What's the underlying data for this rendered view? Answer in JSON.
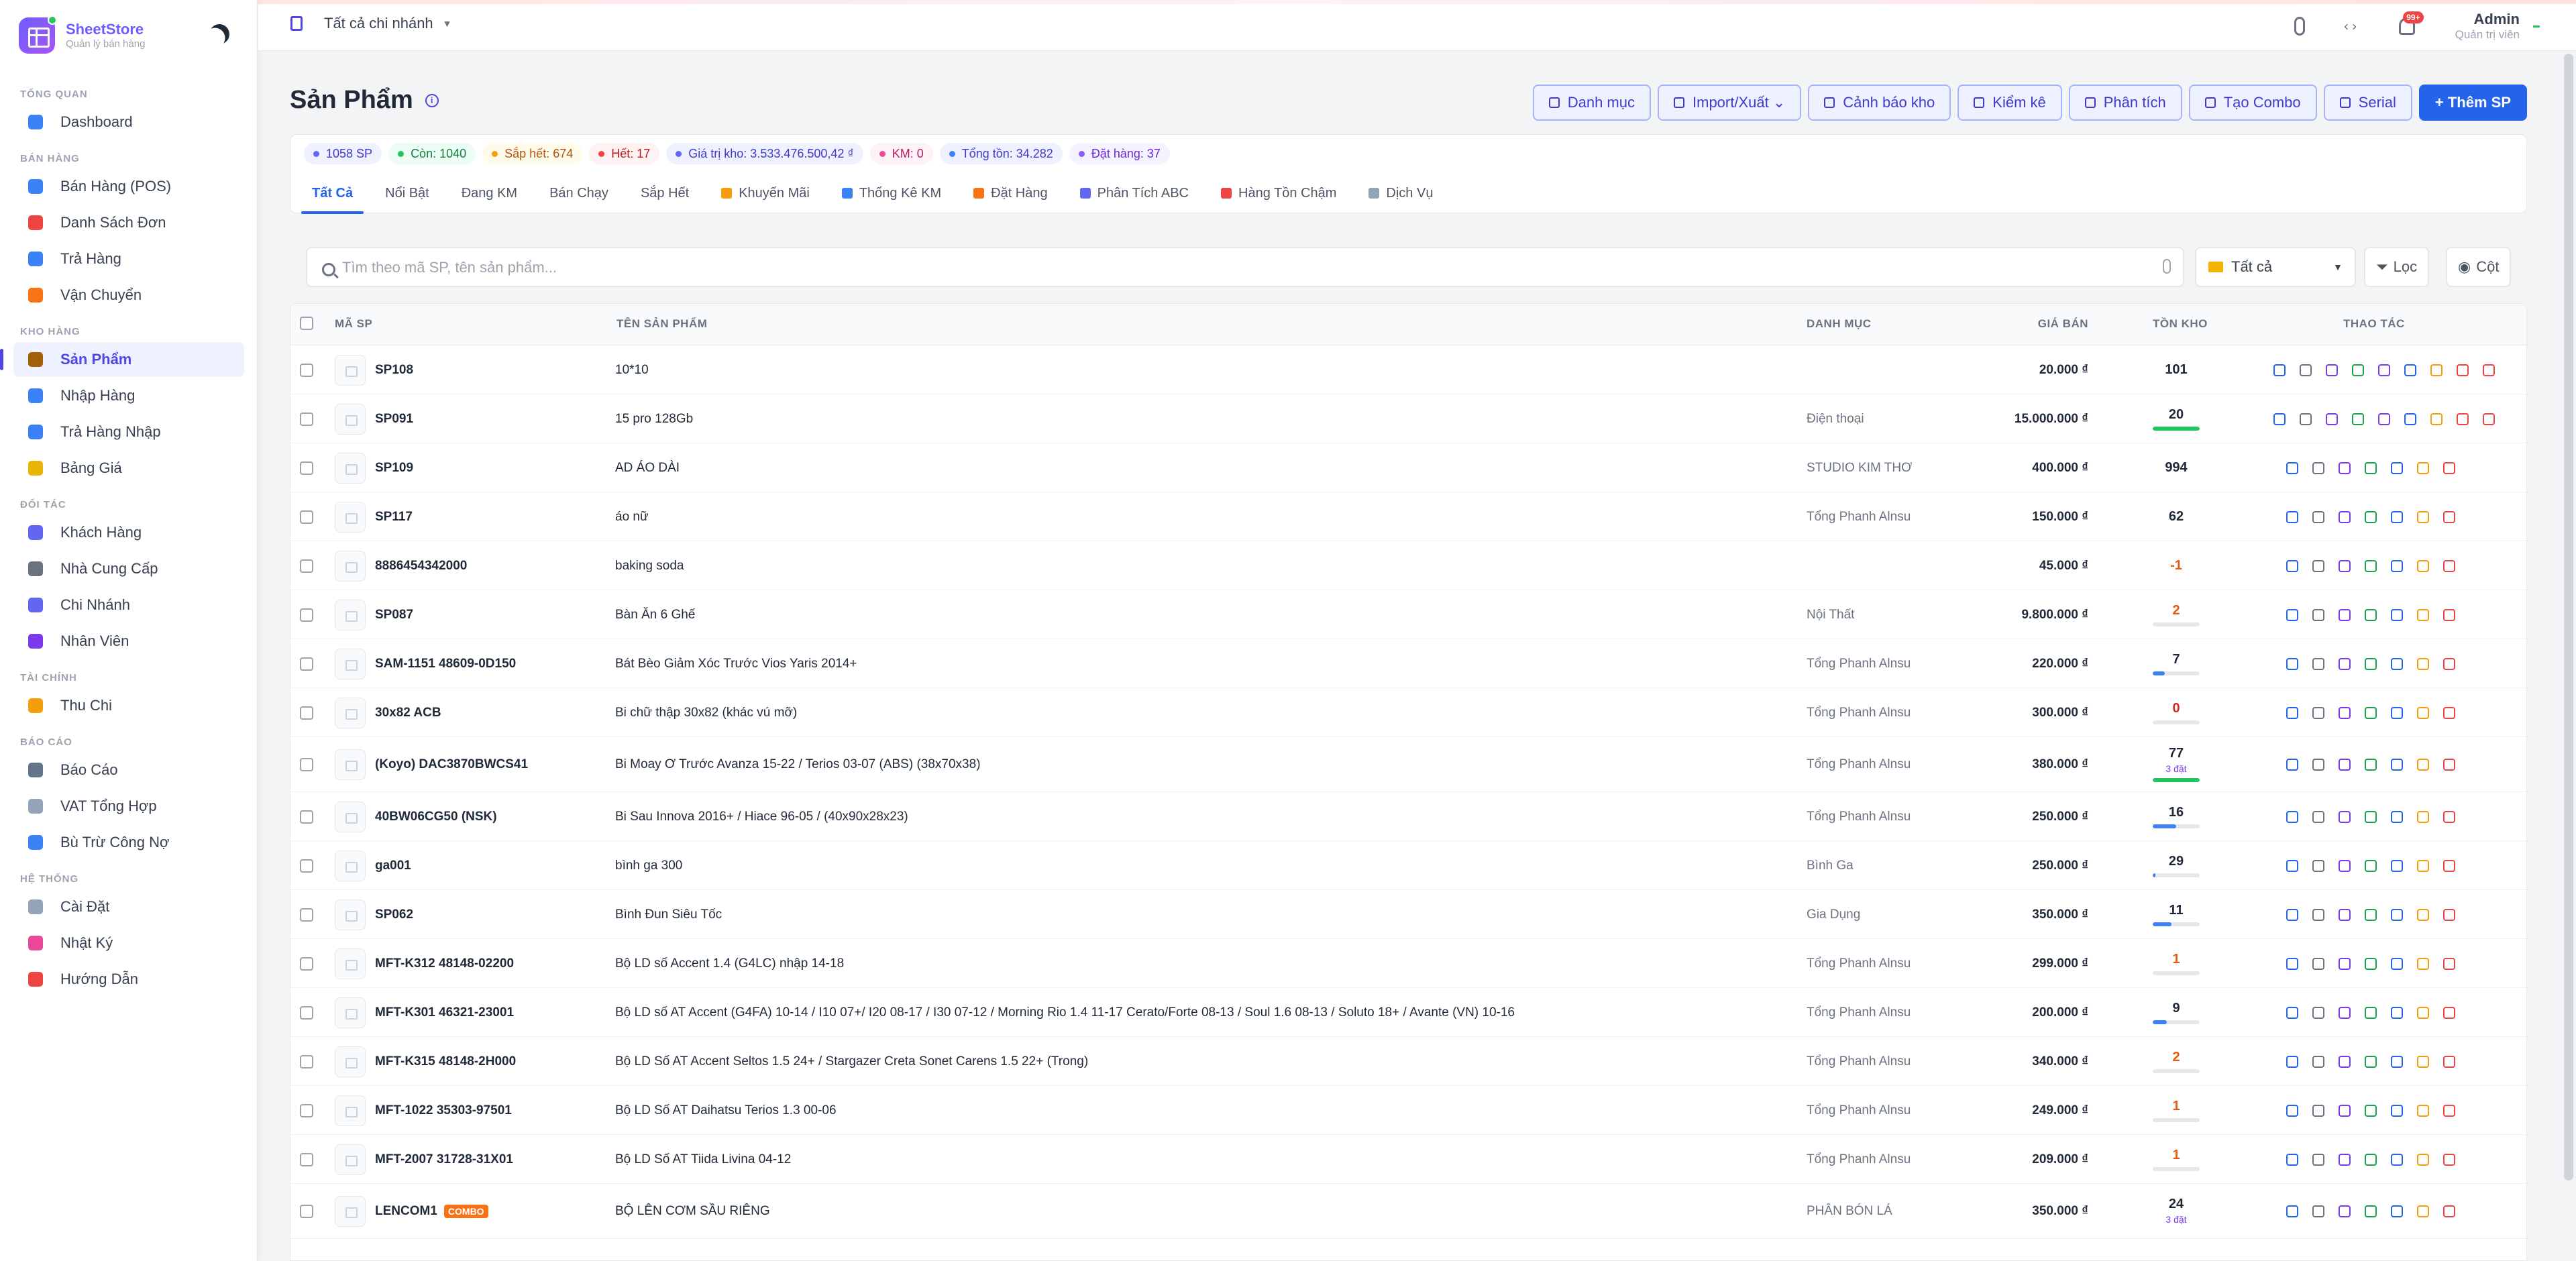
{
  "app": {
    "name": "SheetStore",
    "subtitle": "Quản lý bán hàng"
  },
  "sidebar": {
    "sections": [
      {
        "title": "TỔNG QUAN",
        "items": [
          {
            "label": "Dashboard",
            "color": "#3b82f6"
          }
        ]
      },
      {
        "title": "BÁN HÀNG",
        "items": [
          {
            "label": "Bán Hàng (POS)",
            "color": "#3b82f6"
          },
          {
            "label": "Danh Sách Đơn",
            "color": "#ef4444"
          },
          {
            "label": "Trả Hàng",
            "color": "#3b82f6"
          },
          {
            "label": "Vận Chuyển",
            "color": "#f97316"
          }
        ]
      },
      {
        "title": "KHO HÀNG",
        "items": [
          {
            "label": "Sản Phẩm",
            "color": "#a16207",
            "active": true
          },
          {
            "label": "Nhập Hàng",
            "color": "#3b82f6"
          },
          {
            "label": "Trả Hàng Nhập",
            "color": "#3b82f6"
          },
          {
            "label": "Bảng Giá",
            "color": "#eab308"
          }
        ]
      },
      {
        "title": "ĐỐI TÁC",
        "items": [
          {
            "label": "Khách Hàng",
            "color": "#6366f1"
          },
          {
            "label": "Nhà Cung Cấp",
            "color": "#6b7280"
          },
          {
            "label": "Chi Nhánh",
            "color": "#6366f1"
          },
          {
            "label": "Nhân Viên",
            "color": "#7c3aed"
          }
        ]
      },
      {
        "title": "TÀI CHÍNH",
        "items": [
          {
            "label": "Thu Chi",
            "color": "#f59e0b"
          }
        ]
      },
      {
        "title": "BÁO CÁO",
        "items": [
          {
            "label": "Báo Cáo",
            "color": "#64748b"
          },
          {
            "label": "VAT Tổng Hợp",
            "color": "#94a3b8"
          },
          {
            "label": "Bù Trừ Công Nợ",
            "color": "#3b82f6"
          }
        ]
      },
      {
        "title": "HỆ THỐNG",
        "items": [
          {
            "label": "Cài Đặt",
            "color": "#94a3b8"
          },
          {
            "label": "Nhật Ký",
            "color": "#ec4899"
          },
          {
            "label": "Hướng Dẫn",
            "color": "#ef4444"
          }
        ]
      }
    ]
  },
  "topbar": {
    "branch": "Tất cả chi nhánh",
    "notif_count": "99+",
    "user_name": "Admin",
    "user_role": "Quản trị viên"
  },
  "page": {
    "title": "Sản Phẩm"
  },
  "actions": [
    {
      "label": "Danh mục"
    },
    {
      "label": "Import/Xuất ⌄"
    },
    {
      "label": "Cảnh báo kho"
    },
    {
      "label": "Kiểm kê"
    },
    {
      "label": "Phân tích"
    },
    {
      "label": "Tạo Combo"
    },
    {
      "label": "Serial"
    },
    {
      "label": "+ Thêm SP",
      "primary": true
    }
  ],
  "stats": [
    {
      "label": "1058 SP",
      "bg": "#eef2ff",
      "fg": "#4338ca",
      "dot": "#6366f1"
    },
    {
      "label": "Còn: 1040",
      "bg": "#ecfdf5",
      "fg": "#15803d",
      "dot": "#22c55e"
    },
    {
      "label": "Sắp hết: 674",
      "bg": "#fffbeb",
      "fg": "#b45309",
      "dot": "#f59e0b"
    },
    {
      "label": "Hết: 17",
      "bg": "#fef2f2",
      "fg": "#b91c1c",
      "dot": "#ef4444"
    },
    {
      "label": "Giá trị kho: 3.533.476.500,42 ₫",
      "bg": "#eef2ff",
      "fg": "#4338ca",
      "dot": "#6366f1"
    },
    {
      "label": "KM: 0",
      "bg": "#fdf2f8",
      "fg": "#be185d",
      "dot": "#ec4899"
    },
    {
      "label": "Tổng tồn: 34.282",
      "bg": "#eef2ff",
      "fg": "#4338ca",
      "dot": "#3b82f6"
    },
    {
      "label": "Đặt hàng: 37",
      "bg": "#f5f3ff",
      "fg": "#6d28d9",
      "dot": "#8b5cf6"
    }
  ],
  "tabs": [
    {
      "label": "Tất Cả",
      "active": true
    },
    {
      "label": "Nổi Bật"
    },
    {
      "label": "Đang KM"
    },
    {
      "label": "Bán Chạy"
    },
    {
      "label": "Sắp Hết"
    },
    {
      "label": "Khuyến Mãi",
      "icon": "#f59e0b"
    },
    {
      "label": "Thống Kê KM",
      "icon": "#3b82f6"
    },
    {
      "label": "Đặt Hàng",
      "icon": "#f97316"
    },
    {
      "label": "Phân Tích ABC",
      "icon": "#6366f1"
    },
    {
      "label": "Hàng Tồn Chậm",
      "icon": "#ef4444"
    },
    {
      "label": "Dịch Vụ",
      "icon": "#94a3b8"
    }
  ],
  "search": {
    "placeholder": "Tìm theo mã SP, tên sản phẩm...",
    "category": "Tất cả",
    "filter": "Lọc",
    "columns": "Cột"
  },
  "table": {
    "headers": {
      "code": "MÃ SP",
      "name": "TÊN SẢN PHẨM",
      "category": "DANH MỤC",
      "price": "GIÁ BÁN",
      "stock": "TỒN KHO",
      "ops": "THAO TÁC"
    },
    "rows": [
      {
        "code": "SP108",
        "name": "10*10",
        "category": "",
        "price": "20.000 ₫",
        "stock": "101",
        "stock_color": "#1f2937",
        "bar": null,
        "ops": 9
      },
      {
        "code": "SP091",
        "name": "15 pro 128Gb",
        "category": "Điện thoại",
        "price": "15.000.000 ₫",
        "stock": "20",
        "stock_color": "#1f2937",
        "bar": 1,
        "bar_color": "#22c55e",
        "ops": 9
      },
      {
        "code": "SP109",
        "name": "AD ÁO DÀI",
        "category": "STUDIO KIM THƠ",
        "price": "400.000 ₫",
        "stock": "994",
        "stock_color": "#1f2937",
        "bar": null,
        "ops": 7
      },
      {
        "code": "SP117",
        "name": "áo nữ",
        "category": "Tổng Phanh Alnsu",
        "price": "150.000 ₫",
        "stock": "62",
        "stock_color": "#1f2937",
        "bar": null,
        "ops": 7
      },
      {
        "code": "8886454342000",
        "name": "baking soda",
        "category": "",
        "price": "45.000 ₫",
        "stock": "-1",
        "stock_color": "#ea580c",
        "bar": null,
        "ops": 7
      },
      {
        "code": "SP087",
        "name": "Bàn Ăn 6 Ghế",
        "category": "Nội Thất",
        "price": "9.800.000 ₫",
        "stock": "2",
        "stock_color": "#ea580c",
        "bar": 0,
        "bar_color": "#f59e0b",
        "ops": 7
      },
      {
        "code": "SAM-1151 48609-0D150",
        "name": "Bát Bèo Giảm Xóc Trước Vios Yaris 2014+",
        "category": "Tổng Phanh Alnsu",
        "price": "220.000 ₫",
        "stock": "7",
        "stock_color": "#1f2937",
        "bar": 0.25,
        "bar_color": "#3b82f6",
        "ops": 7
      },
      {
        "code": "30x82 ACB",
        "name": "Bi chữ thập 30x82 (khác vú mỡ)",
        "category": "Tổng Phanh Alnsu",
        "price": "300.000 ₫",
        "stock": "0",
        "stock_color": "#dc2626",
        "bar": 0,
        "bar_color": "#ef4444",
        "ops": 7
      },
      {
        "code": "(Koyo) DAC3870BWCS41",
        "name": "Bi Moay Ơ Trước Avanza 15-22 / Terios 03-07 (ABS) (38x70x38)",
        "category": "Tổng Phanh Alnsu",
        "price": "380.000 ₫",
        "stock": "77",
        "stock_color": "#1f2937",
        "bar": 1,
        "bar_color": "#22c55e",
        "order": "3 đặt",
        "ops": 7
      },
      {
        "code": "40BW06CG50 (NSK)",
        "name": "Bi Sau Innova 2016+ / Hiace 96-05 / (40x90x28x23)",
        "category": "Tổng Phanh Alnsu",
        "price": "250.000 ₫",
        "stock": "16",
        "stock_color": "#1f2937",
        "bar": 0.5,
        "bar_color": "#3b82f6",
        "ops": 7
      },
      {
        "code": "ga001",
        "name": "bình ga 300",
        "category": "Bình Ga",
        "price": "250.000 ₫",
        "stock": "29",
        "stock_color": "#1f2937",
        "bar": 0.05,
        "bar_color": "#3b82f6",
        "ops": 7
      },
      {
        "code": "SP062",
        "name": "Bình Đun Siêu Tốc",
        "category": "Gia Dụng",
        "price": "350.000 ₫",
        "stock": "11",
        "stock_color": "#1f2937",
        "bar": 0.4,
        "bar_color": "#3b82f6",
        "ops": 7
      },
      {
        "code": "MFT-K312 48148-02200",
        "name": "Bộ LD số Accent 1.4 (G4LC) nhập 14-18",
        "category": "Tổng Phanh Alnsu",
        "price": "299.000 ₫",
        "stock": "1",
        "stock_color": "#ea580c",
        "bar": 0,
        "bar_color": "#f59e0b",
        "ops": 7
      },
      {
        "code": "MFT-K301 46321-23001",
        "name": "Bộ LD số AT Accent (G4FA) 10-14 / I10 07+/ I20 08-17 / I30 07-12 / Morning Rio 1.4 11-17 Cerato/Forte 08-13 / Soul 1.6 08-13 / Soluto 18+ / Avante (VN) 10-16",
        "category": "Tổng Phanh Alnsu",
        "price": "200.000 ₫",
        "stock": "9",
        "stock_color": "#1f2937",
        "bar": 0.3,
        "bar_color": "#3b82f6",
        "ops": 7
      },
      {
        "code": "MFT-K315 48148-2H000",
        "name": "Bộ LD Số AT Accent Seltos 1.5 24+ / Stargazer Creta Sonet Carens 1.5 22+ (Trong)",
        "category": "Tổng Phanh Alnsu",
        "price": "340.000 ₫",
        "stock": "2",
        "stock_color": "#ea580c",
        "bar": 0,
        "bar_color": "#f59e0b",
        "ops": 7
      },
      {
        "code": "MFT-1022 35303-97501",
        "name": "Bộ LD Số AT Daihatsu Terios 1.3 00-06",
        "category": "Tổng Phanh Alnsu",
        "price": "249.000 ₫",
        "stock": "1",
        "stock_color": "#ea580c",
        "bar": 0,
        "bar_color": "#f59e0b",
        "ops": 7
      },
      {
        "code": "MFT-2007 31728-31X01",
        "name": "Bộ LD Số AT Tiida Livina 04-12",
        "category": "Tổng Phanh Alnsu",
        "price": "209.000 ₫",
        "stock": "1",
        "stock_color": "#ea580c",
        "bar": 0,
        "bar_color": "#f59e0b",
        "ops": 7
      },
      {
        "code": "LENCOM1",
        "name": "BỘ LÊN CƠM SẦU RIÊNG",
        "category": "PHÂN BÓN LÁ",
        "price": "350.000 ₫",
        "stock": "24",
        "stock_color": "#1f2937",
        "bar": null,
        "order": "3 đặt",
        "combo": "COMBO",
        "ops": 7
      }
    ]
  }
}
